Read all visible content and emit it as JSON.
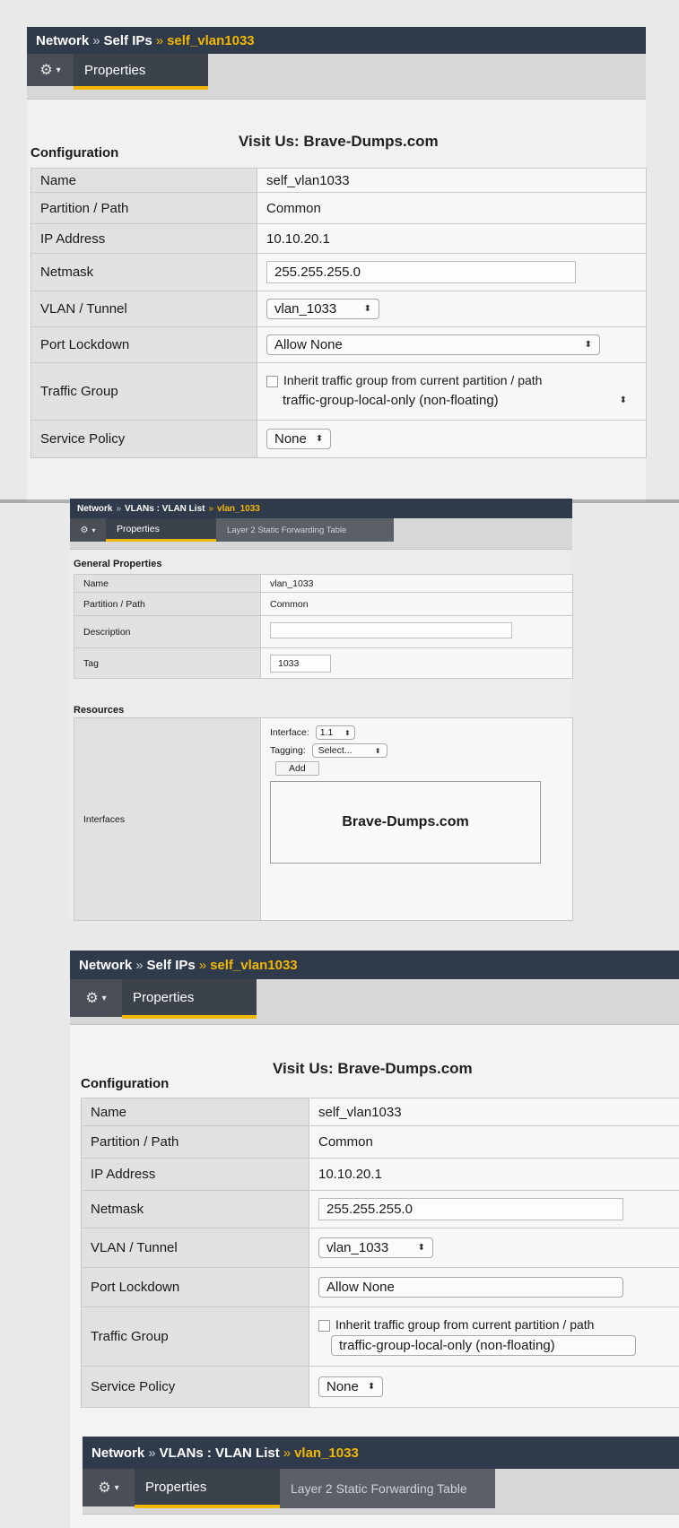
{
  "panel1": {
    "breadcrumb": {
      "root": "Network",
      "sep1": "»",
      "mid": "Self IPs",
      "sep2": "»",
      "current": "self_vlan1033"
    },
    "gear": "⚙",
    "gear_caret": "▾",
    "tabs": [
      "Properties"
    ],
    "section": "Configuration",
    "watermark": "Visit Us: Brave-Dumps.com",
    "rows": {
      "name_label": "Name",
      "name_value": "self_vlan1033",
      "partition_label": "Partition / Path",
      "partition_value": "Common",
      "ip_label": "IP Address",
      "ip_value": "10.10.20.1",
      "netmask_label": "Netmask",
      "netmask_value": "255.255.255.0",
      "vlan_label": "VLAN / Tunnel",
      "vlan_value": "vlan_1033",
      "port_label": "Port Lockdown",
      "port_value": "Allow None",
      "tg_label": "Traffic Group",
      "tg_inherit": "Inherit traffic group from current partition / path",
      "tg_value": "traffic-group-local-only (non-floating)",
      "sp_label": "Service Policy",
      "sp_value": "None"
    }
  },
  "panel2": {
    "breadcrumb": {
      "root": "Network",
      "sep1": "»",
      "mid": "VLANs : VLAN List",
      "sep2": "»",
      "current": "vlan_1033"
    },
    "gear": "⚙",
    "gear_caret": "▾",
    "tabs": [
      "Properties",
      "Layer 2 Static Forwarding Table"
    ],
    "section_general": "General Properties",
    "rows": {
      "name_label": "Name",
      "name_value": "vlan_1033",
      "partition_label": "Partition / Path",
      "partition_value": "Common",
      "desc_label": "Description",
      "desc_value": "",
      "tag_label": "Tag",
      "tag_value": "1033"
    },
    "section_resources": "Resources",
    "interfaces": {
      "label": "Interfaces",
      "interface_label": "Interface:",
      "interface_value": "1.1",
      "tagging_label": "Tagging:",
      "tagging_value": "Select...",
      "add_label": "Add",
      "watermark": "Brave-Dumps.com"
    }
  },
  "panel3": {
    "breadcrumb": {
      "root": "Network",
      "sep1": "»",
      "mid": "Self IPs",
      "sep2": "»",
      "current": "self_vlan1033"
    },
    "gear": "⚙",
    "gear_caret": "▾",
    "tabs": [
      "Properties"
    ],
    "section": "Configuration",
    "watermark": "Visit Us: Brave-Dumps.com",
    "rows": {
      "name_label": "Name",
      "name_value": "self_vlan1033",
      "partition_label": "Partition / Path",
      "partition_value": "Common",
      "ip_label": "IP Address",
      "ip_value": "10.10.20.1",
      "netmask_label": "Netmask",
      "netmask_value": "255.255.255.0",
      "vlan_label": "VLAN / Tunnel",
      "vlan_value": "vlan_1033",
      "port_label": "Port Lockdown",
      "port_value": "Allow None",
      "tg_label": "Traffic Group",
      "tg_inherit": "Inherit traffic group from current partition / path",
      "tg_value": "traffic-group-local-only (non-floating)",
      "sp_label": "Service Policy",
      "sp_value": "None"
    },
    "breadcrumb2": {
      "root": "Network",
      "sep1": "»",
      "mid": "VLANs : VLAN List",
      "sep2": "»",
      "current": "vlan_1033"
    },
    "tabs2": [
      "Properties",
      "Layer 2 Static Forwarding Table"
    ]
  },
  "icons": {
    "select_arrows": "⬍"
  }
}
